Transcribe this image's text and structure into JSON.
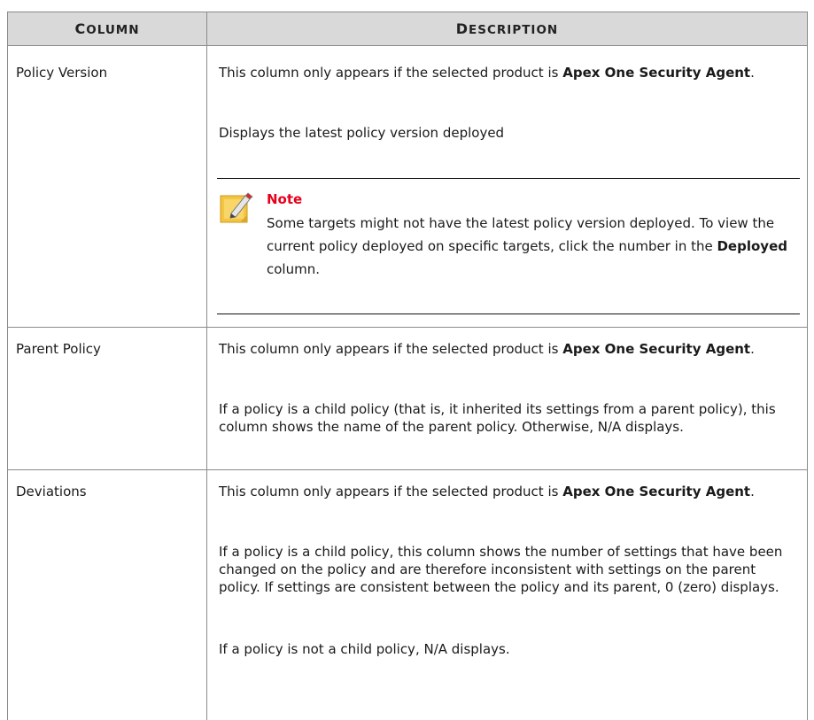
{
  "header": {
    "column_first": "C",
    "column_rest": "OLUMN",
    "description_first": "D",
    "description_rest": "ESCRIPTION"
  },
  "rows": [
    {
      "name": "Policy Version",
      "intro_pre": "This column only appears if the selected product is ",
      "intro_bold": "Apex One Security Agent",
      "intro_post": ".",
      "para2": "Displays the latest policy version deployed",
      "note": {
        "title": "Note",
        "text_pre": "Some targets might not have the latest policy version deployed. To view the current policy deployed on specific targets, click the number in the ",
        "text_bold": "Deployed",
        "text_post": " column.",
        "icon": "note-pencil-icon"
      }
    },
    {
      "name": "Parent Policy",
      "intro_pre": "This column only appears if the selected product is ",
      "intro_bold": "Apex One Security Agent",
      "intro_post": ".",
      "para2": "If a policy is a child policy (that is, it inherited its settings from a parent policy), this column shows the name of the parent policy. Otherwise, N/A displays."
    },
    {
      "name": "Deviations",
      "intro_pre": "This column only appears if the selected product is ",
      "intro_bold": "Apex One Security Agent",
      "intro_post": ".",
      "para2": "If a policy is a child policy, this column shows the number of settings that have been changed on the policy and are therefore inconsistent with settings on the parent policy. If settings are consistent between the policy and its parent, 0 (zero) displays.",
      "para3": "If a policy is not a child policy, N/A displays."
    }
  ],
  "colors": {
    "note_title": "#e8001c",
    "header_bg": "#d9d9d9",
    "note_icon": "#f5c542"
  }
}
